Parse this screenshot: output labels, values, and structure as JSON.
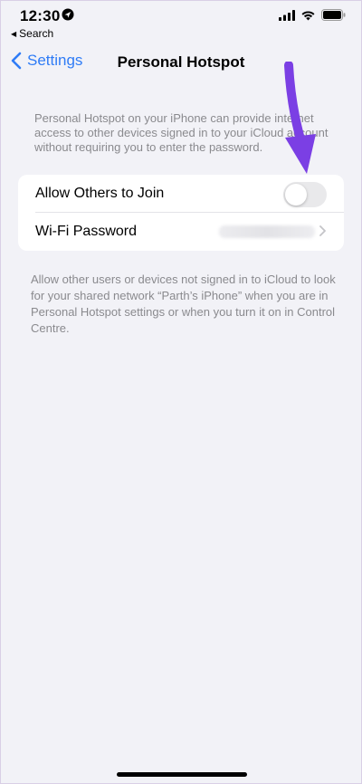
{
  "status_bar": {
    "time": "12:30",
    "back_app": "Search",
    "icons": [
      "location-icon",
      "cellular-signal-icon",
      "wifi-icon",
      "battery-icon"
    ]
  },
  "nav": {
    "back_label": "Settings",
    "title": "Personal Hotspot"
  },
  "description_top": "Personal Hotspot on your iPhone can provide internet access to other devices signed in to your iCloud account without requiring you to enter the password.",
  "settings": {
    "allow_others": {
      "label": "Allow Others to Join",
      "enabled": false
    },
    "wifi_password": {
      "label": "Wi-Fi Password"
    }
  },
  "description_bottom": "Allow other users or devices not signed in to iCloud to look for your shared network “Parth’s iPhone” when you are in Personal Hotspot settings or when you turn it on in Control Centre.",
  "colors": {
    "background": "#f2f2f7",
    "accent": "#2f7cf6",
    "annotation_arrow": "#7b3fe4",
    "toggle_off": "#e9e9eb"
  }
}
